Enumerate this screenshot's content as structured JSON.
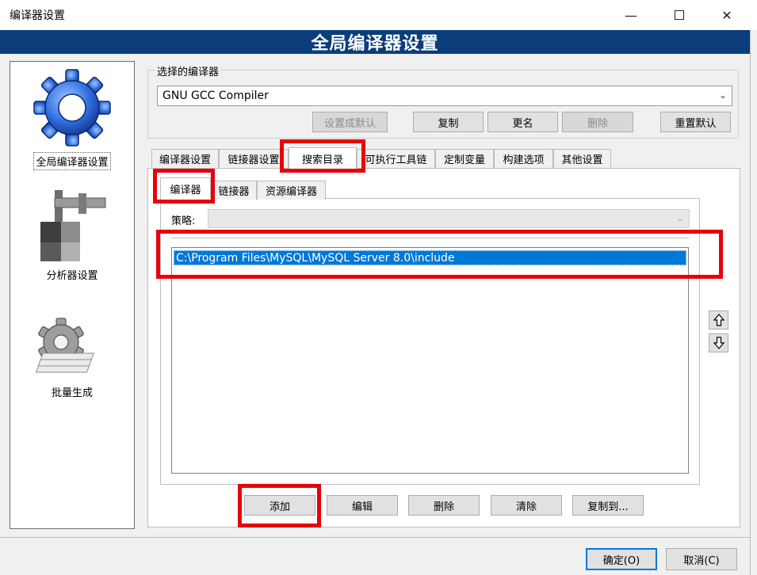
{
  "window": {
    "title": "编译器设置"
  },
  "banner": {
    "title": "全局编译器设置"
  },
  "sidebar": {
    "items": [
      {
        "label": "全局编译器设置",
        "selected": true,
        "icon": "gear-icon"
      },
      {
        "label": "分析器设置",
        "selected": false,
        "icon": "caliper-icon"
      },
      {
        "label": "批量生成",
        "selected": false,
        "icon": "gear-papers-icon"
      }
    ]
  },
  "compiler_group": {
    "legend": "选择的编译器",
    "selected_compiler": "GNU GCC Compiler",
    "buttons": {
      "set_default": "设置成默认",
      "copy": "复制",
      "rename": "更名",
      "delete": "删除",
      "reset_defaults": "重置默认"
    }
  },
  "tabs": [
    {
      "label": "编译器设置"
    },
    {
      "label": "链接器设置"
    },
    {
      "label": "搜索目录",
      "active": true
    },
    {
      "label": "可执行工具链"
    },
    {
      "label": "定制变量"
    },
    {
      "label": "构建选项"
    },
    {
      "label": "其他设置"
    }
  ],
  "subtabs": [
    {
      "label": "编译器",
      "active": true
    },
    {
      "label": "链接器"
    },
    {
      "label": "资源编译器"
    }
  ],
  "search_dirs": {
    "policy_label": "策略:",
    "policy_value": "",
    "entries": [
      "C:\\Program Files\\MySQL\\MySQL Server 8.0\\include"
    ]
  },
  "list_buttons": {
    "add": "添加",
    "edit": "编辑",
    "delete": "删除",
    "clear": "清除",
    "copy_to": "复制到..."
  },
  "dialog_buttons": {
    "ok": "确定(O)",
    "cancel": "取消(C)"
  },
  "colors": {
    "banner": "#0a3d7a",
    "selection": "#0078d7",
    "highlight": "#e8000b"
  }
}
